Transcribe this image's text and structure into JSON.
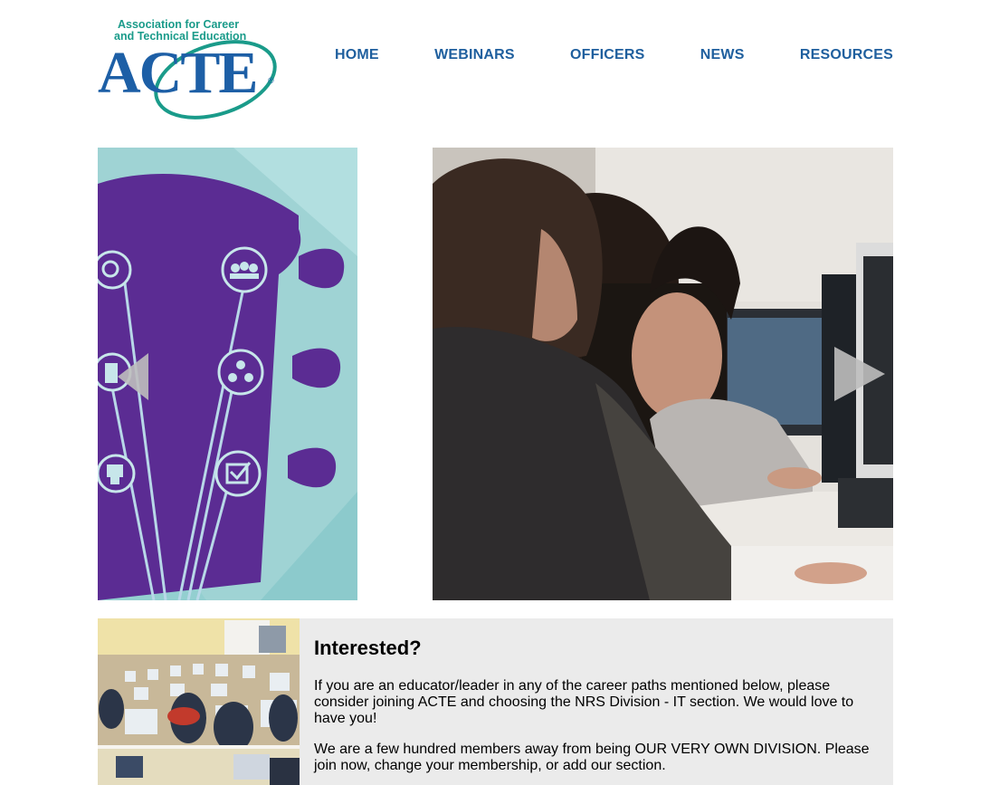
{
  "logo": {
    "line1": "Association for Career",
    "line2": "and Technical Education",
    "name": "ACTE",
    "registered": "®",
    "colors": {
      "blue": "#1d5fa6",
      "teal": "#1a9b8a"
    }
  },
  "nav": {
    "items": [
      {
        "label": "HOME"
      },
      {
        "label": "WEBINARS"
      },
      {
        "label": "OFFICERS"
      },
      {
        "label": "NEWS"
      },
      {
        "label": "RESOURCES"
      }
    ],
    "color": "#1f5f9e"
  },
  "slider": {
    "prev_icon": "triangle-left-icon",
    "next_icon": "triangle-right-icon"
  },
  "interested": {
    "title": "Interested?",
    "paragraph1": "If you are an educator/leader in any of the career paths mentioned below, please consider joining ACTE and choosing the NRS Division - IT section. We would love to have you!",
    "paragraph2": "We are a few hundred members away from being OUR VERY OWN DIVISION. Please join now, change your membership, or add our section."
  }
}
